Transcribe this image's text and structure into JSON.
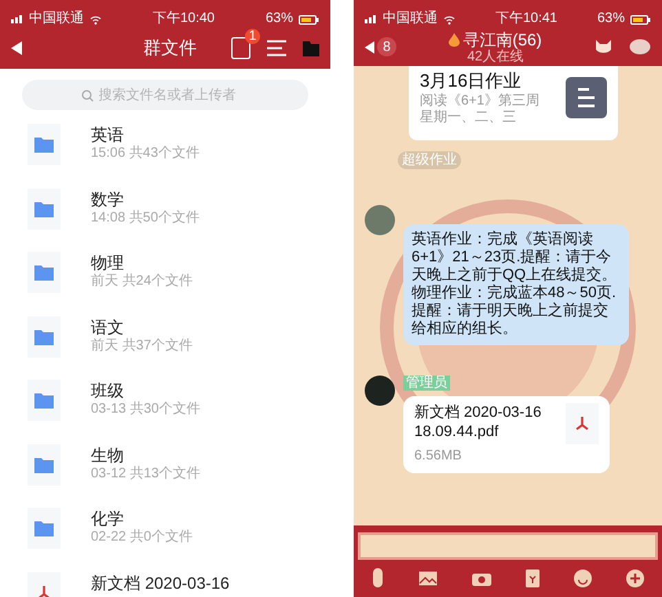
{
  "left": {
    "status_bar": {
      "carrier": "中国联通",
      "time": "下午10:40",
      "battery": "63%"
    },
    "header": {
      "title": "群文件",
      "badge": "1"
    },
    "search": {
      "placeholder": "搜索文件名或者上传者"
    },
    "files": [
      {
        "kind": "folder",
        "name": "英语",
        "meta": "15:06 共43个文件"
      },
      {
        "kind": "folder",
        "name": "数学",
        "meta": "14:08 共50个文件"
      },
      {
        "kind": "folder",
        "name": "物理",
        "meta": "前天 共24个文件"
      },
      {
        "kind": "folder",
        "name": "语文",
        "meta": "前天 共37个文件"
      },
      {
        "kind": "folder",
        "name": "班级",
        "meta": "03-13 共30个文件"
      },
      {
        "kind": "folder",
        "name": "生物",
        "meta": "03-12 共13个文件"
      },
      {
        "kind": "folder",
        "name": "化学",
        "meta": "02-22 共0个文件"
      },
      {
        "kind": "pdf",
        "name": "新文档 2020-03-16"
      }
    ]
  },
  "right": {
    "status_bar": {
      "carrier": "中国联通",
      "time": "下午10:41",
      "battery": "63%"
    },
    "header": {
      "back_count": "8",
      "title": "寻江南(56)",
      "subtitle": "42人在线"
    },
    "messages": [
      {
        "kind": "card",
        "title": "3月16日作业",
        "lines": [
          "阅读《6+1》第三周",
          "星期一、二、三"
        ],
        "tag": "超级作业"
      },
      {
        "kind": "text",
        "text": "英语作业：完成《英语阅读6+1》21～23页.提醒：请于今天晚上之前于QQ上在线提交。物理作业：完成蓝本48～50页.提醒：请于明天晚上之前提交给相应的组长。"
      },
      {
        "kind": "file",
        "badge": "管理员",
        "name": "新文档 2020-03-16 18.09.44.pdf",
        "size": "6.56MB"
      }
    ]
  }
}
